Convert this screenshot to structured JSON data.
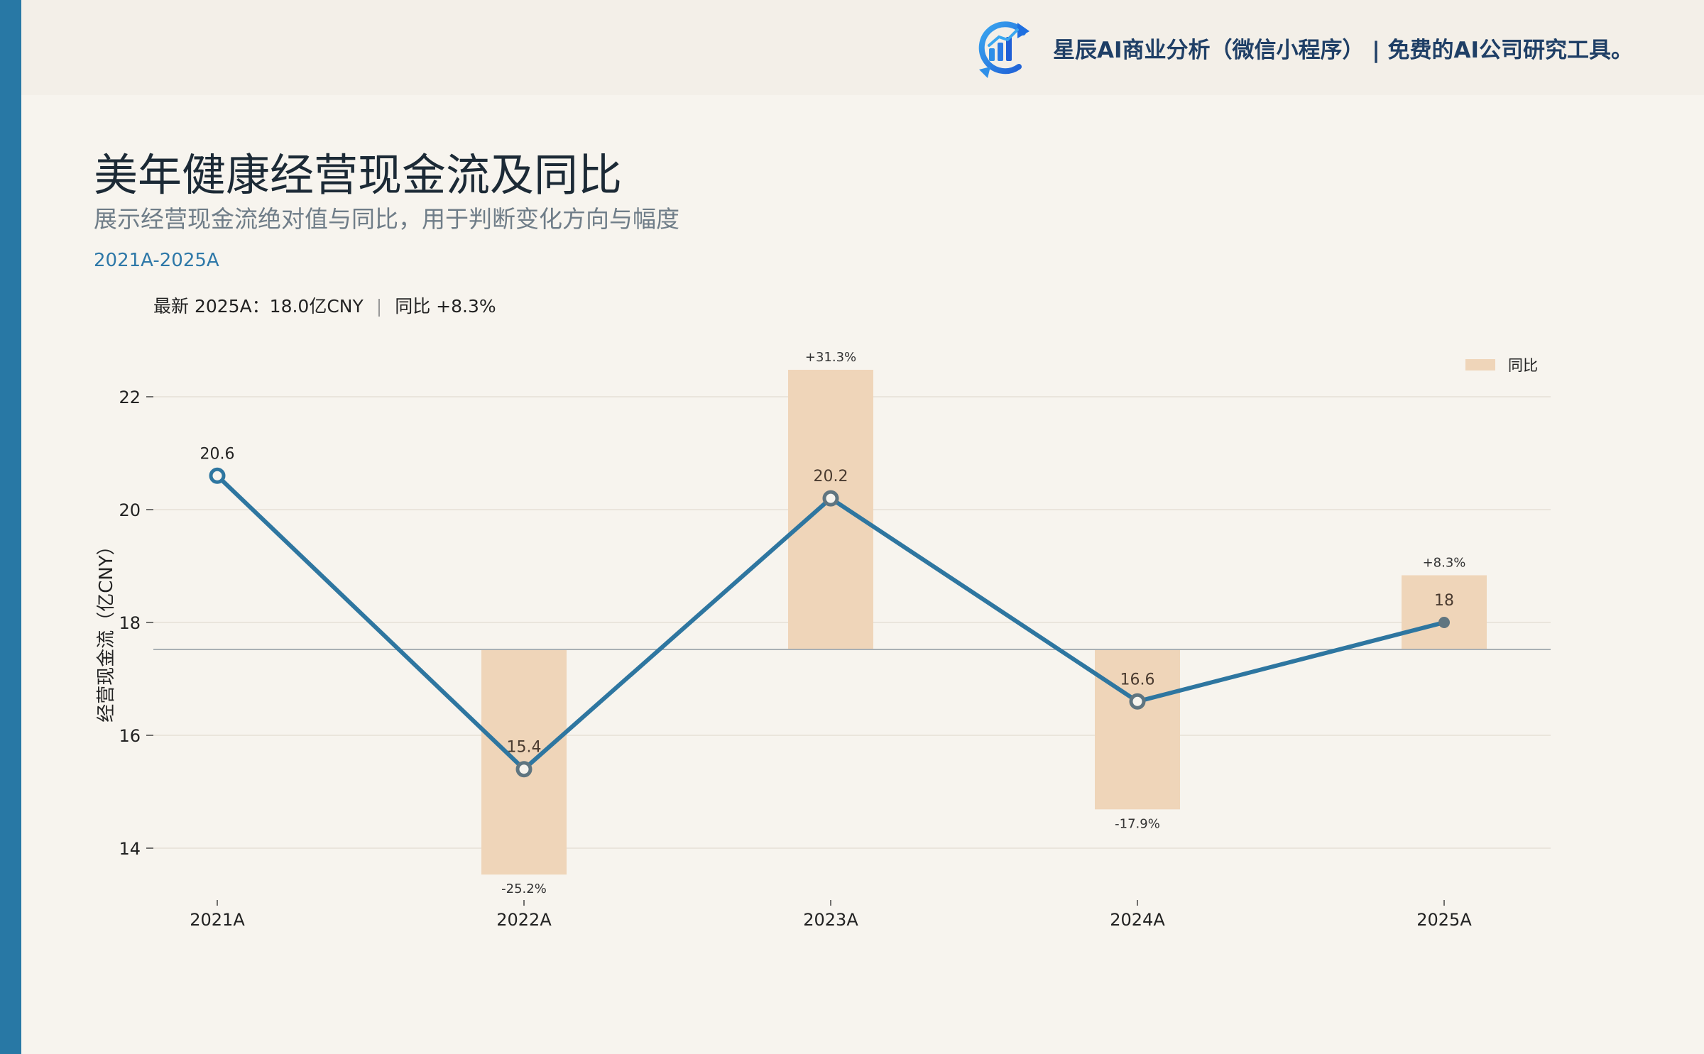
{
  "header": {
    "brand_text": "星辰AI商业分析（微信小程序）  |  免费的AI公司研究工具。",
    "logo_icon": "bar-chart-refresh-icon"
  },
  "title": "美年健康经营现金流及同比",
  "subtitle": "展示经营现金流绝对值与同比，用于判断变化方向与幅度",
  "period": "2021A-2025A",
  "latest": {
    "value_text": "最新 2025A：18.0亿CNY",
    "yoy_text": "同比 +8.3%",
    "separator": "|"
  },
  "colors": {
    "accent": "#2878a5",
    "line": "#2e76a0",
    "bar": "#efd5b9",
    "marker_on_bar": "#5f7580",
    "baseline": "#a9b0b4"
  },
  "chart_data": {
    "type": "line",
    "categories": [
      "2021A",
      "2022A",
      "2023A",
      "2024A",
      "2025A"
    ],
    "series": [
      {
        "values": [
          20.6,
          15.4,
          20.2,
          16.6,
          18.0
        ],
        "point_labels": [
          "20.6",
          "15.4",
          "20.2",
          "16.6",
          "18"
        ]
      }
    ],
    "bars": {
      "name": "同比",
      "values": [
        null,
        -25.2,
        31.3,
        -17.9,
        8.3
      ],
      "labels": [
        "",
        "-25.2%",
        "+31.3%",
        "-17.9%",
        "+8.3%"
      ]
    },
    "ylabel": "经营现金流（亿CNY）",
    "yticks": [
      14,
      16,
      18,
      20,
      22
    ],
    "ylim": [
      13.2,
      23.0
    ],
    "grid": true,
    "legend": {
      "position": "top-right",
      "entries": [
        "同比"
      ]
    }
  }
}
